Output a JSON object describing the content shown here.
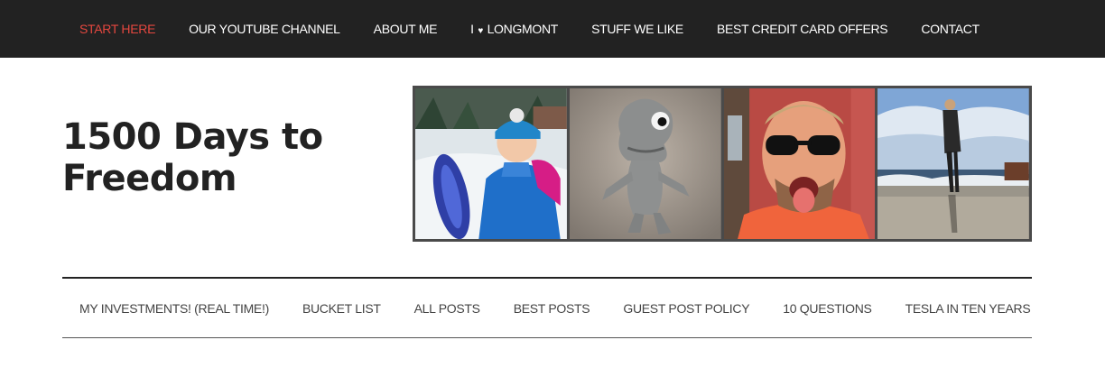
{
  "top_nav": {
    "items": [
      {
        "label": "START HERE",
        "active": true
      },
      {
        "label": "OUR YOUTUBE CHANNEL"
      },
      {
        "label": "ABOUT ME"
      },
      {
        "label_prefix": "I",
        "label_suffix": "LONGMONT",
        "icon": "heart-icon"
      },
      {
        "label": "STUFF WE LIKE"
      },
      {
        "label": "BEST CREDIT CARD OFFERS"
      },
      {
        "label": "CONTACT"
      }
    ],
    "heart_glyph": "♥"
  },
  "site": {
    "title": "1500 Days to Freedom"
  },
  "header_photos": [
    {
      "subject": "girl-with-sled-in-snow"
    },
    {
      "subject": "toy-dinosaur"
    },
    {
      "subject": "man-with-sunglasses-selfie"
    },
    {
      "subject": "woman-on-beach"
    }
  ],
  "secondary_nav": {
    "items": [
      {
        "label": "MY INVESTMENTS! (REAL TIME!)"
      },
      {
        "label": "BUCKET LIST"
      },
      {
        "label": "ALL POSTS"
      },
      {
        "label": "BEST POSTS"
      },
      {
        "label": "GUEST POST POLICY"
      },
      {
        "label": "10 QUESTIONS"
      },
      {
        "label": "TESLA IN TEN YEARS"
      }
    ]
  },
  "colors": {
    "nav_bg": "#222222",
    "accent": "#e4473f",
    "frame": "#4a4a4a"
  }
}
